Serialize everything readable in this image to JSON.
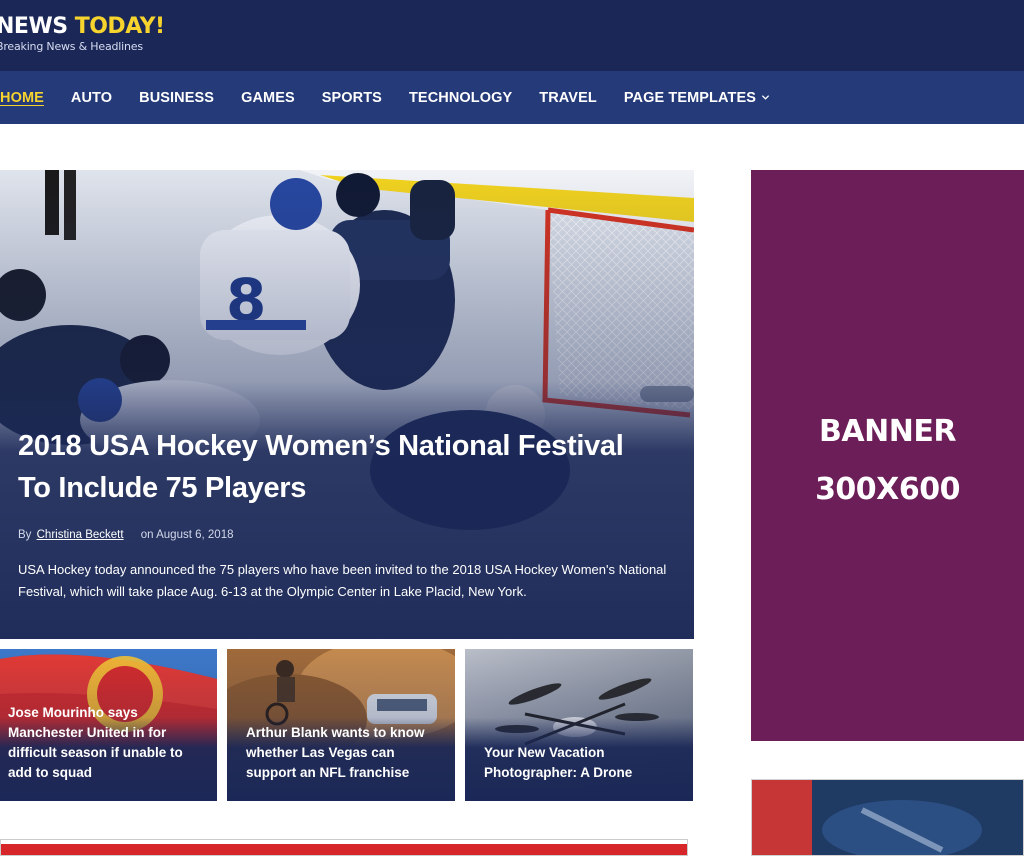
{
  "site": {
    "logo_part1": "NEWS ",
    "logo_part2": "TODAY!",
    "tagline": "Breaking News & Headlines"
  },
  "nav": {
    "items": [
      {
        "label": "HOME",
        "active": true
      },
      {
        "label": "AUTO"
      },
      {
        "label": "BUSINESS"
      },
      {
        "label": "GAMES"
      },
      {
        "label": "SPORTS"
      },
      {
        "label": "TECHNOLOGY"
      },
      {
        "label": "TRAVEL"
      },
      {
        "label": "PAGE TEMPLATES",
        "has_dropdown": true
      }
    ]
  },
  "hero": {
    "title_line1": "2018 USA Hockey Women’s National Festival",
    "title_line2": "To Include 75 Players",
    "by": "By",
    "author": "Christina Beckett",
    "date": "on August 6, 2018",
    "excerpt": "USA Hockey today announced the 75 players who have been invited to the 2018 USA Hockey Women's National Festival, which will take place Aug. 6-13 at the Olympic Center in Lake Placid, New York.",
    "image_icon": "hockey-photo-icon"
  },
  "cards": [
    {
      "title": "Jose Mourinho says Manchester United in for difficult season if unable to add to squad",
      "image_icon": "manchester-flag-photo-icon"
    },
    {
      "title": "Arthur Blank wants to know whether Las Vegas can support an NFL franchise",
      "image_icon": "motocross-photo-icon"
    },
    {
      "title": "Your New Vacation Photographer: A Drone",
      "image_icon": "drone-photo-icon"
    }
  ],
  "sidebar": {
    "banner_line1": "BANNER",
    "banner_line2": "300X600"
  },
  "colors": {
    "header_bg": "#1b2857",
    "nav_bg": "#253a78",
    "accent": "#f6d32d",
    "banner_bg": "#6b1e57"
  }
}
